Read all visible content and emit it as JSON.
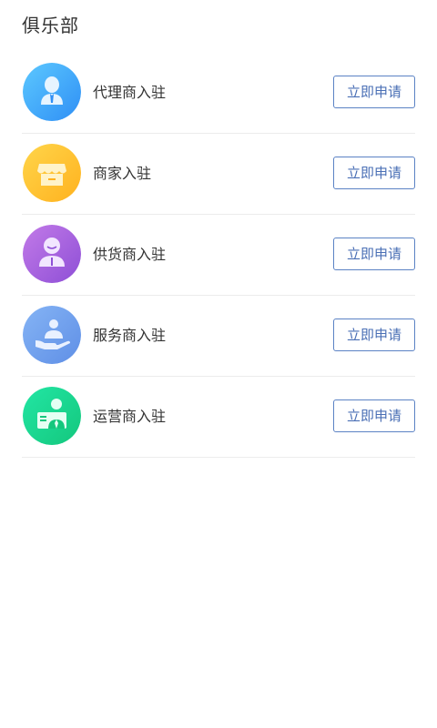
{
  "page": {
    "title": "俱乐部"
  },
  "items": [
    {
      "label": "代理商入驻",
      "icon": "agent-icon",
      "button": "立即申请",
      "color_from": "#5cc8ff",
      "color_to": "#2f8ff5"
    },
    {
      "label": "商家入驻",
      "icon": "shop-icon",
      "button": "立即申请",
      "color_from": "#ffd54a",
      "color_to": "#ffb21f"
    },
    {
      "label": "供货商入驻",
      "icon": "supplier-icon",
      "button": "立即申请",
      "color_from": "#c27ae8",
      "color_to": "#8e4fd6"
    },
    {
      "label": "服务商入驻",
      "icon": "service-icon",
      "button": "立即申请",
      "color_from": "#85b4f5",
      "color_to": "#5f8fe6"
    },
    {
      "label": "运营商入驻",
      "icon": "operator-icon",
      "button": "立即申请",
      "color_from": "#22e6a4",
      "color_to": "#14c77d"
    }
  ],
  "colors": {
    "accent": "#4a6fb5",
    "divider": "#ececec"
  }
}
